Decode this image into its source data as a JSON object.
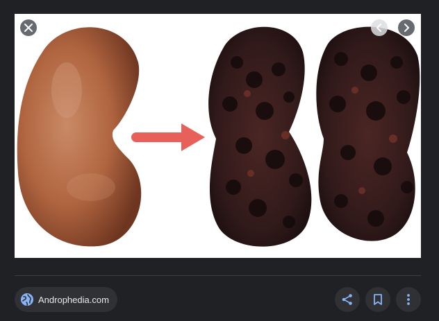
{
  "image": {
    "subject": "kidney",
    "colors": {
      "healthy_kidney": "#b86a47",
      "arrow": "#e8605a",
      "diseased_kidney": "#3a1e1e"
    }
  },
  "controls": {
    "close_icon": "close-icon",
    "prev_icon": "chevron-left-icon",
    "next_icon": "chevron-right-icon"
  },
  "source": {
    "label": "Androphedia.com",
    "icon": "globe-icon",
    "accent": "#8ab4f8"
  },
  "actions": [
    {
      "icon": "share-icon"
    },
    {
      "icon": "bookmark-icon"
    },
    {
      "icon": "more-vert-icon"
    }
  ],
  "theme": {
    "background": "#1f2125",
    "chip": "#303134",
    "text": "#e8eaed"
  }
}
